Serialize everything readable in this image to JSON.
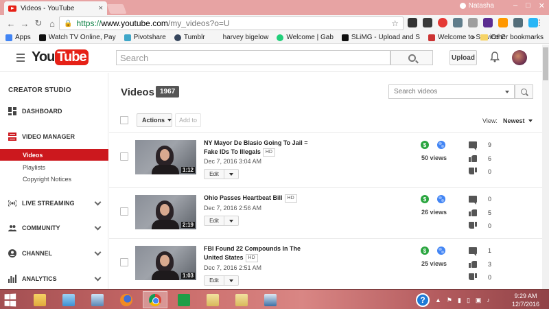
{
  "browser": {
    "tab_title": "Videos - YouTube",
    "tab_close": "×",
    "profile_name": "Natasha",
    "url_prefix": "https://",
    "url_host": "www.youtube.com",
    "url_path": "/my_videos?o=U",
    "bookmarks": [
      {
        "label": "Apps",
        "color": "#4285f4"
      },
      {
        "label": "Watch TV Online, Pay",
        "color": "#111111"
      },
      {
        "label": "Pivotshare",
        "color": "#3fa7c9"
      },
      {
        "label": "Tumblr",
        "color": "#36465d"
      },
      {
        "label": "harvey bigelow",
        "color": "#f5f5f5"
      },
      {
        "label": "Welcome | Gab",
        "color": "#21cf7a"
      },
      {
        "label": "SLiMG - Upload and S",
        "color": "#111111"
      },
      {
        "label": "Welcome to Service C",
        "color": "#cc3333"
      }
    ],
    "overflow": "»",
    "other_bookmarks": "Other bookmarks"
  },
  "masthead": {
    "logo_you": "You",
    "logo_tube": "Tube",
    "search_placeholder": "Search",
    "upload_label": "Upload"
  },
  "sidebar": {
    "title": "CREATOR STUDIO",
    "items": [
      {
        "label": "DASHBOARD"
      },
      {
        "label": "VIDEO MANAGER"
      },
      {
        "label": "LIVE STREAMING"
      },
      {
        "label": "COMMUNITY"
      },
      {
        "label": "CHANNEL"
      },
      {
        "label": "ANALYTICS"
      }
    ],
    "subitems": [
      {
        "label": "Videos",
        "active": true
      },
      {
        "label": "Playlists"
      },
      {
        "label": "Copyright Notices"
      }
    ],
    "accent_color": "#cc181e"
  },
  "main": {
    "title": "Videos",
    "count": "1967",
    "search_placeholder": "Search videos",
    "actions_label": "Actions",
    "addto_label": "Add to",
    "view_label": "View:",
    "sort_value": "Newest",
    "edit_label": "Edit",
    "videos": [
      {
        "title": "NY Mayor De Blasio Going To Jail = Fake IDs To Illegals",
        "hd": "HD",
        "date": "Dec 7, 2016 3:04 AM",
        "duration": "1:12",
        "views": "50 views",
        "comments": "9",
        "likes": "6",
        "dislikes": "0"
      },
      {
        "title": "Ohio Passes Heartbeat Bill",
        "hd": "HD",
        "date": "Dec 7, 2016 2:56 AM",
        "duration": "2:19",
        "views": "26 views",
        "comments": "0",
        "likes": "5",
        "dislikes": "0"
      },
      {
        "title": "FBI Found 22 Compounds In The United States",
        "hd": "HD",
        "date": "Dec 7, 2016 2:51 AM",
        "duration": "1:03",
        "views": "25 views",
        "comments": "1",
        "likes": "3",
        "dislikes": "0"
      }
    ]
  },
  "taskbar": {
    "time": "9:29 AM",
    "date": "12/7/2016",
    "help": "?"
  }
}
